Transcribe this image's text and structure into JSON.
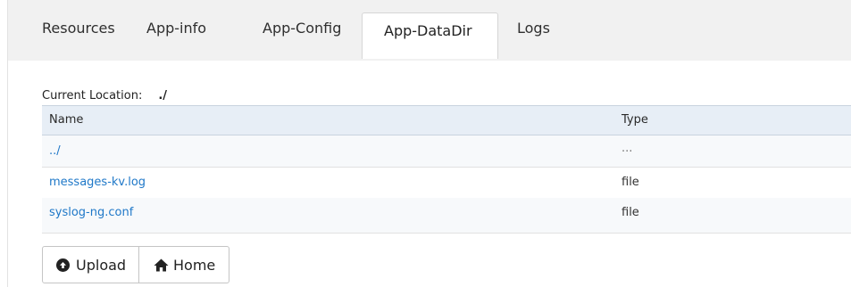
{
  "tabs": [
    {
      "label": "Resources"
    },
    {
      "label": "App-info"
    },
    {
      "label": "App-Config"
    },
    {
      "label": "App-DataDir",
      "active": true
    },
    {
      "label": "Logs"
    }
  ],
  "location": {
    "label": "Current Location:",
    "value": "./"
  },
  "table": {
    "columns": [
      "Name",
      "Type"
    ],
    "rows": [
      {
        "name": "../",
        "type": "..."
      },
      {
        "name": "messages-kv.log",
        "type": "file"
      },
      {
        "name": "syslog-ng.conf",
        "type": "file"
      }
    ]
  },
  "buttons": {
    "upload_label": "Upload",
    "home_label": "Home"
  },
  "icons": {
    "upload": "upload-circle-icon",
    "home": "home-icon"
  },
  "colors": {
    "link": "#1f78c8",
    "header_bg": "#e7eef6",
    "tabbar_bg": "#f1f1f1"
  }
}
